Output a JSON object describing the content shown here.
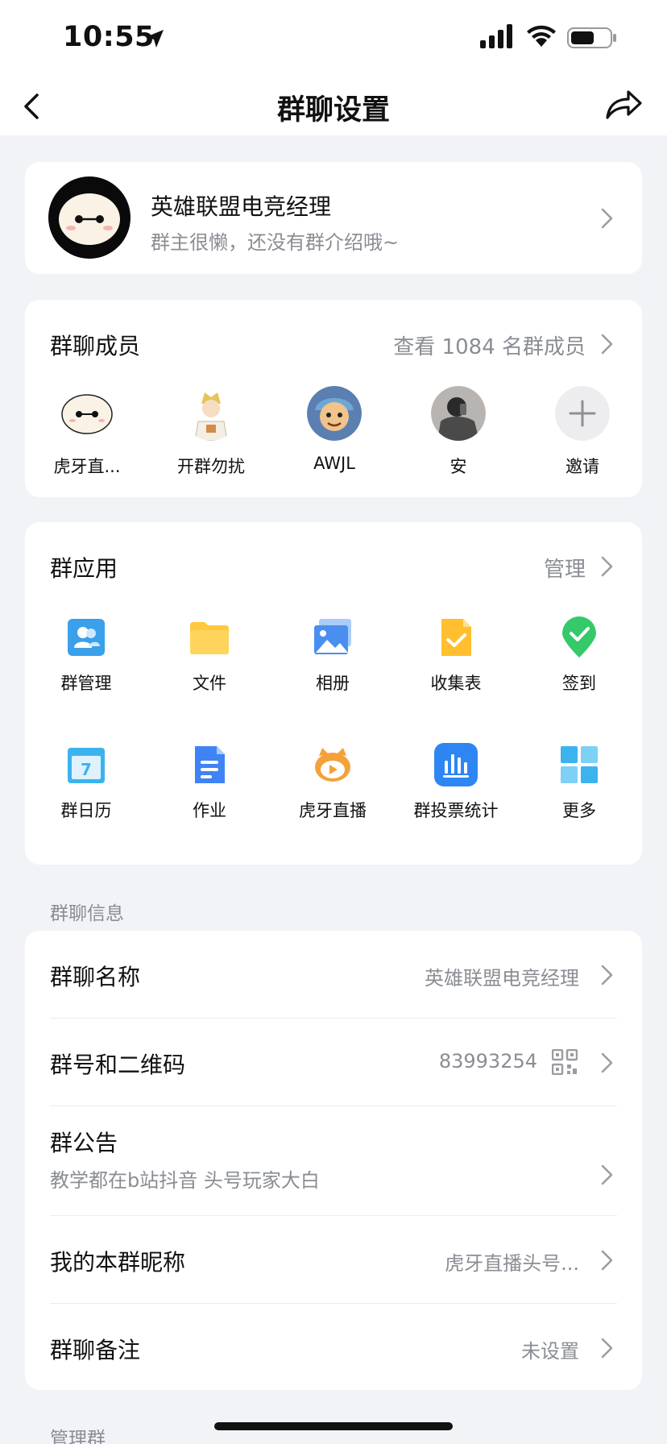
{
  "status_bar": {
    "time": "10:55"
  },
  "nav": {
    "title": "群聊设置"
  },
  "group": {
    "name": "英雄联盟电竞经理",
    "intro": "群主很懒，还没有群介绍哦~"
  },
  "members": {
    "title": "群聊成员",
    "view_all": "查看 1084 名群成员",
    "list": [
      {
        "name": "虎牙直..."
      },
      {
        "name": "开群勿扰"
      },
      {
        "name": "AWJL"
      },
      {
        "name": "安"
      },
      {
        "name": "邀请"
      }
    ]
  },
  "apps": {
    "title": "群应用",
    "manage": "管理",
    "items": [
      {
        "label": "群管理",
        "icon": "group-manage-icon",
        "color": "#3aa0ea"
      },
      {
        "label": "文件",
        "icon": "folder-icon",
        "color": "#ffc83d"
      },
      {
        "label": "相册",
        "icon": "photo-album-icon",
        "color": "#4a8ff0"
      },
      {
        "label": "收集表",
        "icon": "collection-form-icon",
        "color": "#ffbf2e"
      },
      {
        "label": "签到",
        "icon": "check-in-icon",
        "color": "#35c96a"
      },
      {
        "label": "群日历",
        "icon": "calendar-icon",
        "color": "#3cb3ee"
      },
      {
        "label": "作业",
        "icon": "homework-icon",
        "color": "#3f83f5"
      },
      {
        "label": "虎牙直播",
        "icon": "huya-live-icon",
        "color": "#f5a139"
      },
      {
        "label": "群投票统计",
        "icon": "vote-stats-icon",
        "color": "#2e86f3"
      },
      {
        "label": "更多",
        "icon": "more-grid-icon",
        "color": "#3cb3ee"
      }
    ]
  },
  "info": {
    "section_label": "群聊信息",
    "name_label": "群聊名称",
    "name_value": "英雄联盟电竞经理",
    "number_label": "群号和二维码",
    "number_value": "83993254",
    "notice_label": "群公告",
    "notice_value": "教学都在b站抖音 头号玩家大白",
    "nickname_label": "我的本群昵称",
    "nickname_value": "虎牙直播头号...",
    "remark_label": "群聊备注",
    "remark_value": "未设置"
  },
  "next_section_label": "管理群"
}
